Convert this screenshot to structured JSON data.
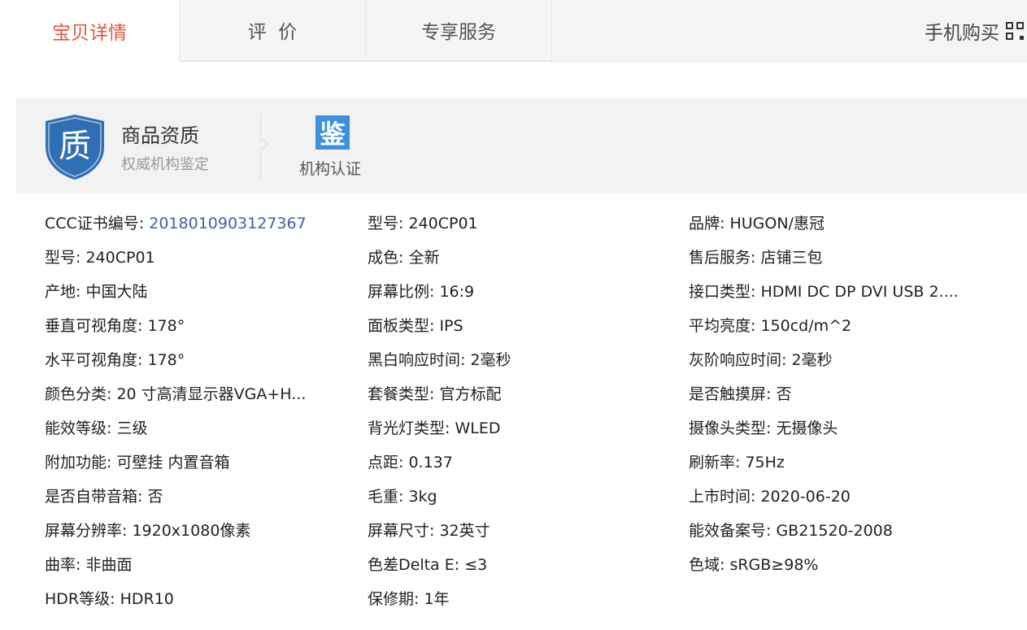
{
  "tabs": [
    {
      "label": "宝贝详情",
      "active": true
    },
    {
      "label": "评  价",
      "active": false
    },
    {
      "label": "专享服务",
      "active": false
    }
  ],
  "mobile_buy": {
    "label": "手机购买",
    "icon": "qr-code-icon"
  },
  "quality": {
    "shield_char": "质",
    "title": "商品资质",
    "subtitle": "权威机构鉴定",
    "cert_char": "鉴",
    "cert_label": "机构认证"
  },
  "colors": {
    "accent": "#e4573c",
    "link": "#3a63a8",
    "badge": "#3d8fe0",
    "shield": "#2f6fb6"
  },
  "attributes": [
    [
      {
        "label": "CCC证书编号:",
        "value": "2018010903127367",
        "link": true
      },
      {
        "label": "型号:",
        "value": "240CP01"
      },
      {
        "label": "产地:",
        "value": "中国大陆"
      },
      {
        "label": "垂直可视角度:",
        "value": "178°"
      },
      {
        "label": "水平可视角度:",
        "value": "178°"
      },
      {
        "label": "颜色分类:",
        "value": "20 寸高清显示器VGA+H..."
      },
      {
        "label": "能效等级:",
        "value": "三级"
      },
      {
        "label": "附加功能:",
        "value": "可壁挂 内置音箱"
      },
      {
        "label": "是否自带音箱:",
        "value": "否"
      },
      {
        "label": "屏幕分辨率:",
        "value": "1920x1080像素"
      },
      {
        "label": "曲率:",
        "value": "非曲面"
      },
      {
        "label": "HDR等级:",
        "value": "HDR10"
      }
    ],
    [
      {
        "label": "型号:",
        "value": "240CP01"
      },
      {
        "label": "成色:",
        "value": "全新"
      },
      {
        "label": "屏幕比例:",
        "value": "16:9"
      },
      {
        "label": "面板类型:",
        "value": "IPS"
      },
      {
        "label": "黑白响应时间:",
        "value": "2毫秒"
      },
      {
        "label": "套餐类型:",
        "value": "官方标配"
      },
      {
        "label": "背光灯类型:",
        "value": "WLED"
      },
      {
        "label": "点距:",
        "value": "0.137"
      },
      {
        "label": "毛重:",
        "value": "3kg"
      },
      {
        "label": "屏幕尺寸:",
        "value": "32英寸"
      },
      {
        "label": "色差Delta E:",
        "value": "≤3"
      },
      {
        "label": "保修期:",
        "value": "1年"
      }
    ],
    [
      {
        "label": "品牌:",
        "value": "HUGON/惠冠"
      },
      {
        "label": "售后服务:",
        "value": "店铺三包"
      },
      {
        "label": "接口类型:",
        "value": "HDMI DC DP DVI USB 2...."
      },
      {
        "label": "平均亮度:",
        "value": "150cd/m^2"
      },
      {
        "label": "灰阶响应时间:",
        "value": "2毫秒"
      },
      {
        "label": "是否触摸屏:",
        "value": "否"
      },
      {
        "label": "摄像头类型:",
        "value": "无摄像头"
      },
      {
        "label": "刷新率:",
        "value": "75Hz"
      },
      {
        "label": "上市时间:",
        "value": "2020-06-20"
      },
      {
        "label": "能效备案号:",
        "value": "GB21520-2008"
      },
      {
        "label": "色域:",
        "value": "sRGB≥98%"
      }
    ]
  ]
}
